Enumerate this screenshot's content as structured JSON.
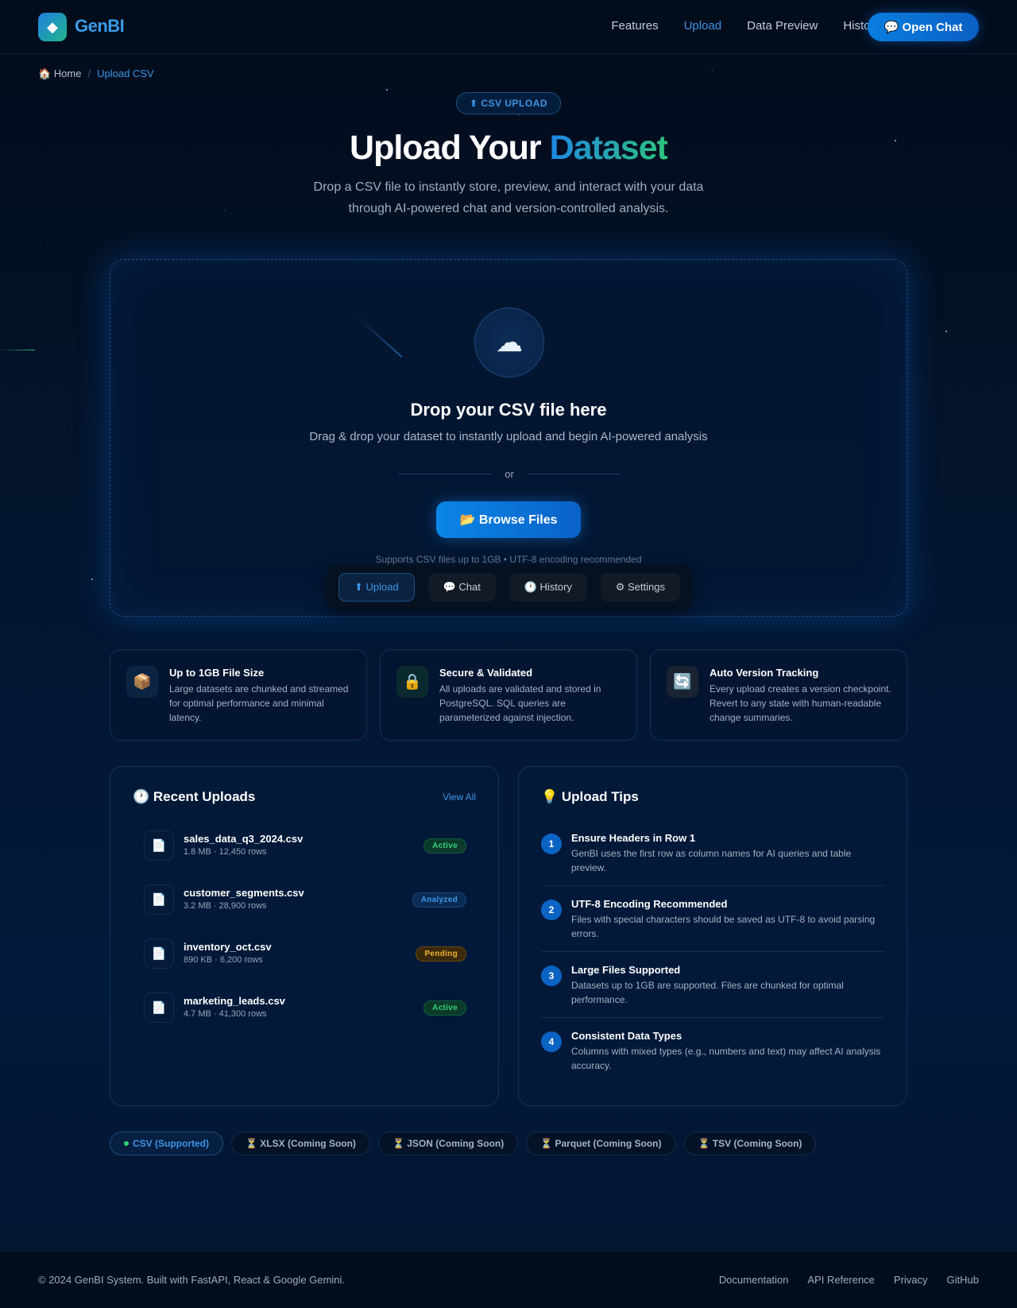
{
  "brand": {
    "name": "GenBI"
  },
  "nav": {
    "links": [
      "Features",
      "Upload",
      "Data Preview",
      "History"
    ],
    "active": "Upload",
    "cta": "💬 Open Chat"
  },
  "breadcrumb": {
    "home": "🏠 Home",
    "sep": "/",
    "current": "Upload CSV"
  },
  "hero": {
    "badge": "⬆ CSV UPLOAD",
    "title_plain": "Upload Your",
    "title_accent": "Dataset",
    "subtitle": "Drop a CSV file to instantly store, preview, and interact with your data through AI-powered chat and version-controlled analysis."
  },
  "dropzone": {
    "icon": "cloud-upload-icon",
    "title": "Drop your CSV file here",
    "subtitle": "Drag & drop your dataset to instantly upload and begin AI-powered analysis",
    "or": "or",
    "browse": "📂 Browse Files",
    "supports": "Supports CSV files up to 1GB • UTF-8 encoding recommended",
    "tabs": [
      "⬆ Upload",
      "💬 Chat",
      "🕐 History",
      "⚙ Settings"
    ]
  },
  "features": [
    {
      "icon": "📦",
      "title": "Up to 1GB File Size",
      "desc": "Large datasets are chunked and streamed for optimal performance and minimal latency."
    },
    {
      "icon": "🔒",
      "title": "Secure & Validated",
      "desc": "All uploads are validated and stored in PostgreSQL. SQL queries are parameterized against injection."
    },
    {
      "icon": "🔄",
      "title": "Auto Version Tracking",
      "desc": "Every upload creates a version checkpoint. Revert to any state with human-readable change summaries."
    }
  ],
  "recent": {
    "title": "🕐 Recent Uploads",
    "view_all": "View All",
    "items": [
      {
        "name": "sales_data_q3_2024.csv",
        "meta": "1.8 MB · 12,450 rows",
        "status": "Active"
      },
      {
        "name": "customer_segments.csv",
        "meta": "3.2 MB · 28,900 rows",
        "status": "Analyzed"
      },
      {
        "name": "inventory_oct.csv",
        "meta": "890 KB · 6,200 rows",
        "status": "Pending"
      },
      {
        "name": "marketing_leads.csv",
        "meta": "4.7 MB · 41,300 rows",
        "status": "Active"
      }
    ]
  },
  "tips": {
    "title": "💡 Upload Tips",
    "items": [
      {
        "n": "1",
        "title": "Ensure Headers in Row 1",
        "desc": "GenBI uses the first row as column names for AI queries and table preview."
      },
      {
        "n": "2",
        "title": "UTF-8 Encoding Recommended",
        "desc": "Files with special characters should be saved as UTF-8 to avoid parsing errors."
      },
      {
        "n": "3",
        "title": "Large Files Supported",
        "desc": "Datasets up to 1GB are supported. Files are chunked for optimal performance."
      },
      {
        "n": "4",
        "title": "Consistent Data Types",
        "desc": "Columns with mixed types (e.g., numbers and text) may affect AI analysis accuracy."
      }
    ]
  },
  "formats": [
    "CSV (Supported)",
    "⏳ XLSX (Coming Soon)",
    "⏳ JSON (Coming Soon)",
    "⏳ Parquet (Coming Soon)",
    "⏳ TSV (Coming Soon)"
  ],
  "footer": {
    "copy": "© 2024 GenBI System. Built with FastAPI, React & Google Gemini.",
    "links": [
      "Documentation",
      "API Reference",
      "Privacy",
      "GitHub"
    ]
  },
  "colors": {
    "accent": "#3e95e6",
    "green": "#2ec47c",
    "background": "#031630"
  }
}
